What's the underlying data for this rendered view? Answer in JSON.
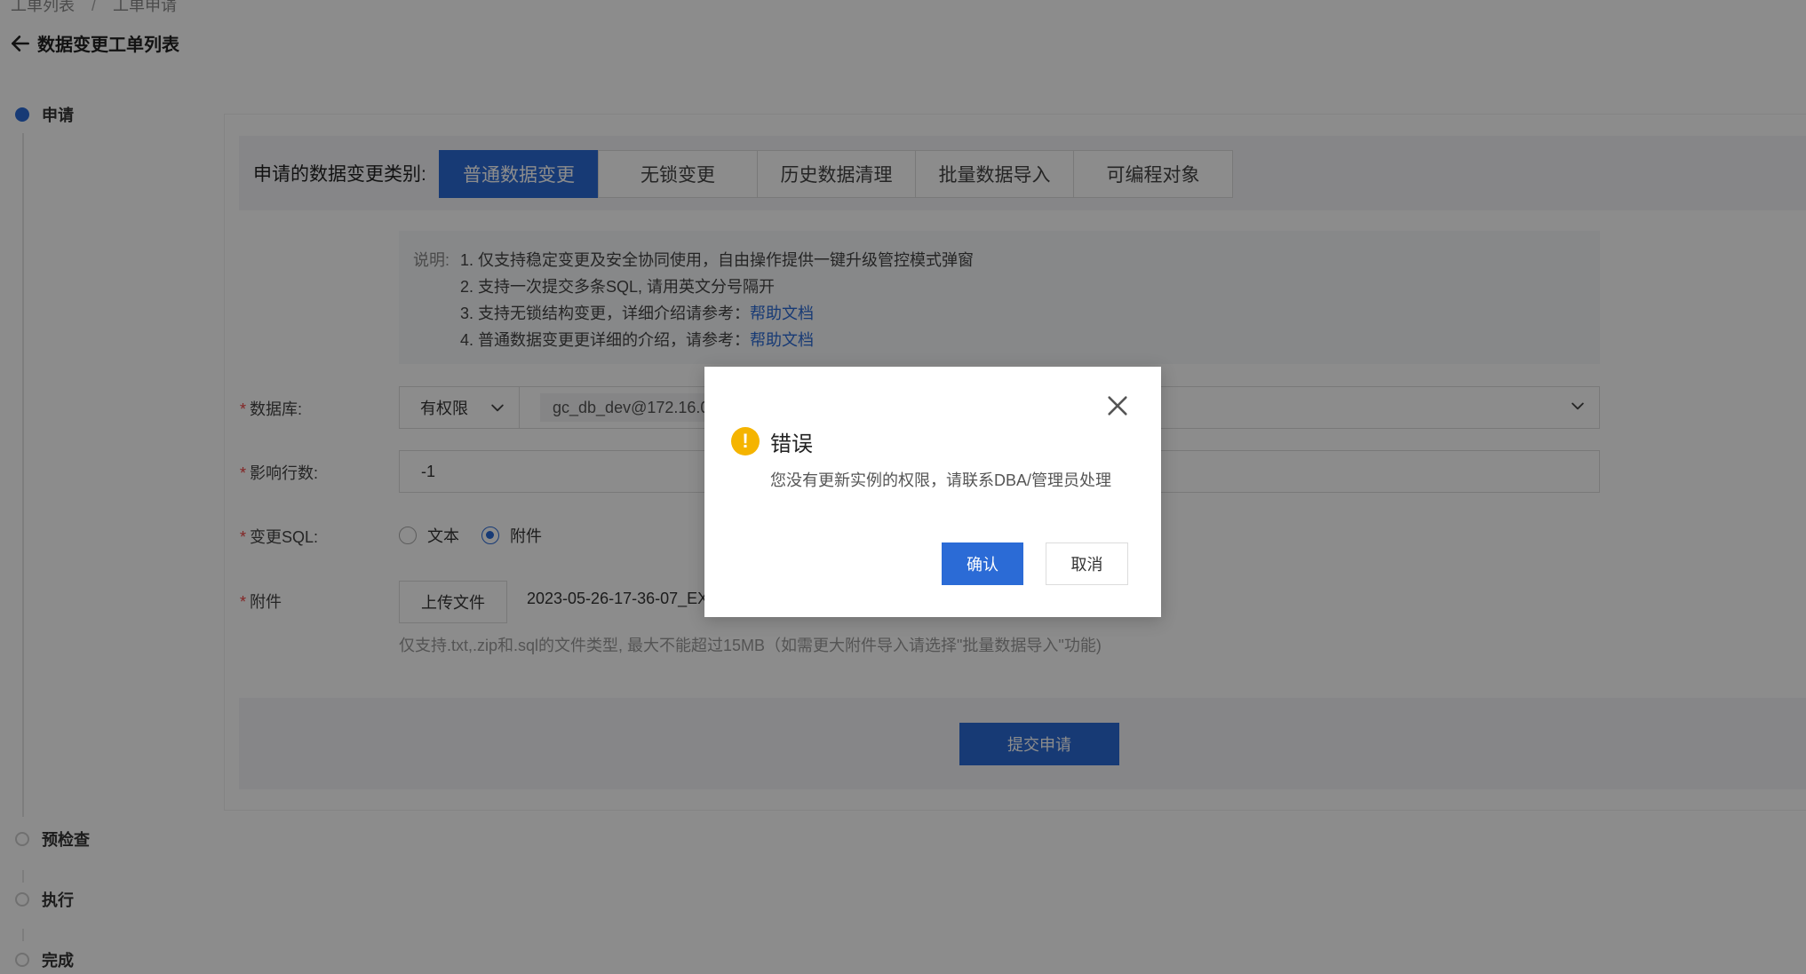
{
  "breadcrumb": {
    "items": [
      "工单列表",
      "工单申请"
    ],
    "separator": "/"
  },
  "back": {
    "label": "数据变更工单列表",
    "icon": "arrow-left-icon"
  },
  "steps": [
    {
      "label": "申请",
      "active": true
    },
    {
      "label": "预检查",
      "active": false
    },
    {
      "label": "执行",
      "active": false
    },
    {
      "label": "完成",
      "active": false
    }
  ],
  "change_type": {
    "label": "申请的数据变更类别:",
    "tabs": [
      "普通数据变更",
      "无锁变更",
      "历史数据清理",
      "批量数据导入",
      "可编程对象"
    ],
    "selected": "普通数据变更"
  },
  "description": {
    "prefix": "说明:",
    "lines": [
      "1. 仅支持稳定变更及安全协同使用，自由操作提供一键升级管控模式弹窗",
      "2. 支持一次提交多条SQL, 请用英文分号隔开",
      "3. 支持无锁结构变更，详细介绍请参考：",
      "4. 普通数据变更更详细的介绍，请参考："
    ],
    "link_text": "帮助文档"
  },
  "form": {
    "required_mark": "*",
    "database": {
      "label": "数据库:",
      "permission": "有权限",
      "value": "gc_db_dev@172.16.0"
    },
    "affected_rows": {
      "label": "影响行数:",
      "value": "-1"
    },
    "change_sql": {
      "label": "变更SQL:",
      "options": [
        "文本",
        "附件"
      ],
      "selected": "附件"
    },
    "attachment": {
      "label": "附件",
      "upload_label": "上传文件",
      "file_name": "2023-05-26-17-36-07_EX",
      "hint": "仅支持.txt,.zip和.sql的文件类型, 最大不能超过15MB（如需更大附件导入请选择\"批量数据导入\"功能)"
    }
  },
  "submit_label": "提交申请",
  "modal": {
    "title": "错误",
    "message": "您没有更新实例的权限，请联系DBA/管理员处理",
    "ok_label": "确认",
    "cancel_label": "取消",
    "icon": "warning-icon",
    "icon_glyph": "!"
  },
  "colors": {
    "primary": "#2b6bd6",
    "warning": "#f5b400",
    "required": "#e44444"
  }
}
